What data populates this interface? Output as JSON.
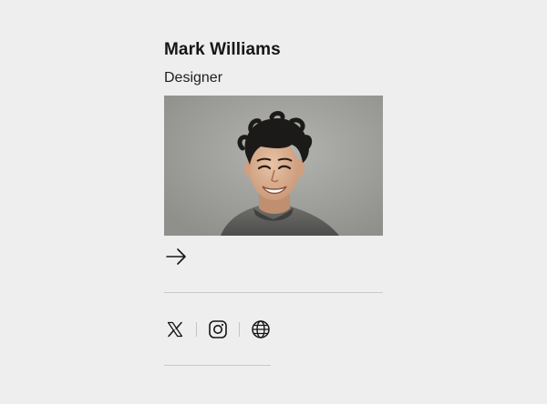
{
  "profile": {
    "name": "Mark Williams",
    "role": "Designer"
  },
  "photo": {
    "subject": "smiling man with curly dark hair, grey knit sweater, grey studio backdrop"
  },
  "actions": {
    "more_icon": "arrow-right-icon"
  },
  "social": [
    {
      "icon": "x-logo-icon"
    },
    {
      "icon": "instagram-icon"
    },
    {
      "icon": "globe-icon"
    }
  ],
  "colors": {
    "background": "#eeeeee",
    "text": "#161616",
    "divider": "#c9c9c9"
  }
}
